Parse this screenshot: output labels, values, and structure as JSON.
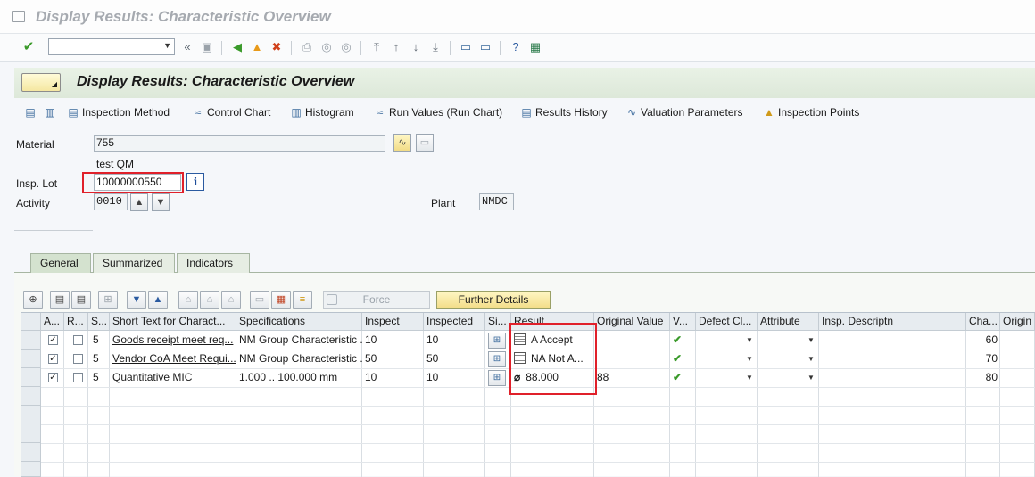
{
  "window": {
    "title": "Display Results: Characteristic Overview"
  },
  "system_toolbar": {
    "command_field": ""
  },
  "header": {
    "title": "Display Results: Characteristic Overview"
  },
  "app_toolbar": [
    {
      "label": "Inspection Method",
      "icon": "inspection-method-icon"
    },
    {
      "label": "Control Chart",
      "icon": "control-chart-icon"
    },
    {
      "label": "Histogram",
      "icon": "histogram-icon"
    },
    {
      "label": "Run Values (Run Chart)",
      "icon": "run-chart-icon"
    },
    {
      "label": "Results History",
      "icon": "results-history-icon"
    },
    {
      "label": "Valuation Parameters",
      "icon": "valuation-parameters-icon"
    },
    {
      "label": "Inspection Points",
      "icon": "inspection-points-icon"
    }
  ],
  "fields": {
    "material_label": "Material",
    "material_value": "755",
    "material_desc": "test QM",
    "insp_lot_label": "Insp. Lot",
    "insp_lot_value": "10000000550",
    "activity_label": "Activity",
    "activity_value": "0010",
    "plant_label": "Plant",
    "plant_value": "NMDC"
  },
  "tabs": [
    {
      "label": "General",
      "active": true
    },
    {
      "label": "Summarized",
      "active": false
    },
    {
      "label": "Indicators",
      "active": false
    }
  ],
  "table_toolbar": {
    "force_label": "Force",
    "further_details_label": "Further Details"
  },
  "table": {
    "headers": [
      "A...",
      "R...",
      "S...",
      "Short Text for Charact...",
      "Specifications",
      "Inspect",
      "Inspected",
      "Si...",
      "Result",
      "Original Value",
      "V...",
      "Defect Cl...",
      "Attribute",
      "Insp. Descriptn",
      "Cha...",
      "Origin I"
    ],
    "rows": [
      {
        "a": "✓",
        "r": "",
        "s": "5",
        "short_text": "Goods receipt meet req...",
        "spec": "NM Group Characteristic ...",
        "inspect": "10",
        "inspected": "10",
        "result": "A Accept",
        "result_icon": "document-icon",
        "orig": "",
        "valid": "✔",
        "cha": "60"
      },
      {
        "a": "✓",
        "r": "",
        "s": "5",
        "short_text": "Vendor CoA Meet Requi...",
        "spec": "NM Group Characteristic ...",
        "inspect": "50",
        "inspected": "50",
        "result": "NA Not A...",
        "result_icon": "document-icon",
        "orig": "",
        "valid": "✔",
        "cha": "70"
      },
      {
        "a": "✓",
        "r": "",
        "s": "5",
        "short_text": "Quantitative MIC",
        "spec": "1.000 .. 100.000 mm",
        "inspect": "10",
        "inspected": "10",
        "result": "88.000",
        "result_icon": "average-icon",
        "orig": "88",
        "valid": "✔",
        "cha": "80"
      }
    ]
  },
  "colors": {
    "highlight_box": "#e0202a",
    "valid_check": "#3a9a2a",
    "header_band": "#dde8d9"
  }
}
